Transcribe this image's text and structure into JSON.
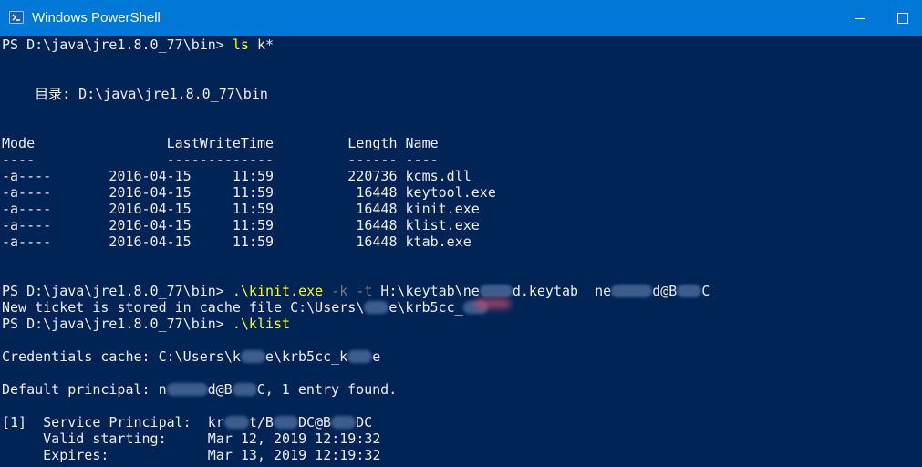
{
  "window": {
    "title": "Windows PowerShell",
    "icon": "powershell-icon",
    "bg_color": "#012456",
    "titlebar_color": "#0078d7"
  },
  "console": {
    "prompt": "PS D:\\java\\jre1.8.0_77\\bin> ",
    "cmd_ls": "ls",
    "cmd_ls_arg": " k*",
    "dir_line": "    目录: D:\\java\\jre1.8.0_77\\bin",
    "header": "Mode                LastWriteTime         Length Name",
    "separator": "----                -------------         ------ ----",
    "files": [
      "-a----       2016-04-15     11:59         220736 kcms.dll",
      "-a----       2016-04-15     11:59          16448 keytool.exe",
      "-a----       2016-04-15     11:59          16448 kinit.exe",
      "-a----       2016-04-15     11:59          16448 klist.exe",
      "-a----       2016-04-15     11:59          16448 ktab.exe"
    ],
    "kinit_cmd": ".\\kinit.exe",
    "kinit_flag_k": " -k",
    "kinit_flag_t": " -t",
    "kinit_path_a": " H:\\keytab\\ne",
    "kinit_path_b": "d.keytab  ne",
    "kinit_principal_b": "d@B",
    "kinit_principal_c": "C",
    "ticket_stored_a": "New ticket is stored in cache file C:\\Users\\",
    "ticket_stored_b": "e\\krb5cc_",
    "klist_cmd": ".\\klist",
    "cred_cache_a": "Credentials cache: C:\\Users\\k",
    "cred_cache_b": "e\\krb5cc_k",
    "cred_cache_c": "e",
    "default_principal_a": "Default principal: n",
    "default_principal_b": "d@B",
    "default_principal_c": "C, 1 entry found.",
    "sp_label": "[1]  Service Principal:  kr",
    "sp_a": "t/B",
    "sp_b": "DC@B",
    "sp_c": "DC",
    "valid_starting": "     Valid starting:     Mar 12, 2019 12:19:32",
    "expires": "     Expires:            Mar 13, 2019 12:19:32"
  }
}
